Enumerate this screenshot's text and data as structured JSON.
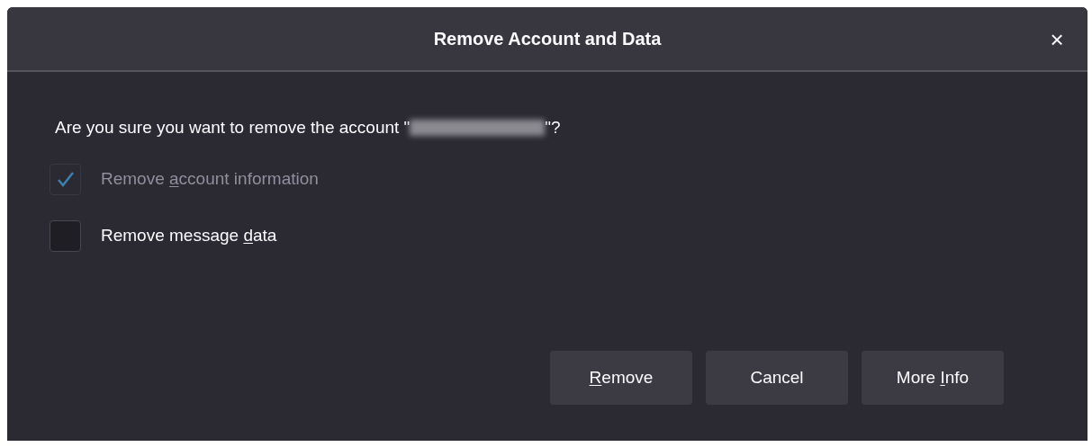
{
  "dialog": {
    "title": "Remove Account and Data",
    "close": "×"
  },
  "prompt": {
    "before": "Are you sure you want to remove the account \"",
    "after": "\"?"
  },
  "options": [
    {
      "label_before": "Remove ",
      "access_key": "a",
      "label_after": "ccount information",
      "checked": true,
      "disabled": true
    },
    {
      "label_before": "Remove message ",
      "access_key": "d",
      "label_after": "ata",
      "checked": false,
      "disabled": false
    }
  ],
  "buttons": [
    {
      "access_key": "R",
      "label_after": "emove"
    },
    {
      "label_before": "Cancel"
    },
    {
      "label_before": "More ",
      "access_key": "I",
      "label_after": "nfo"
    }
  ]
}
